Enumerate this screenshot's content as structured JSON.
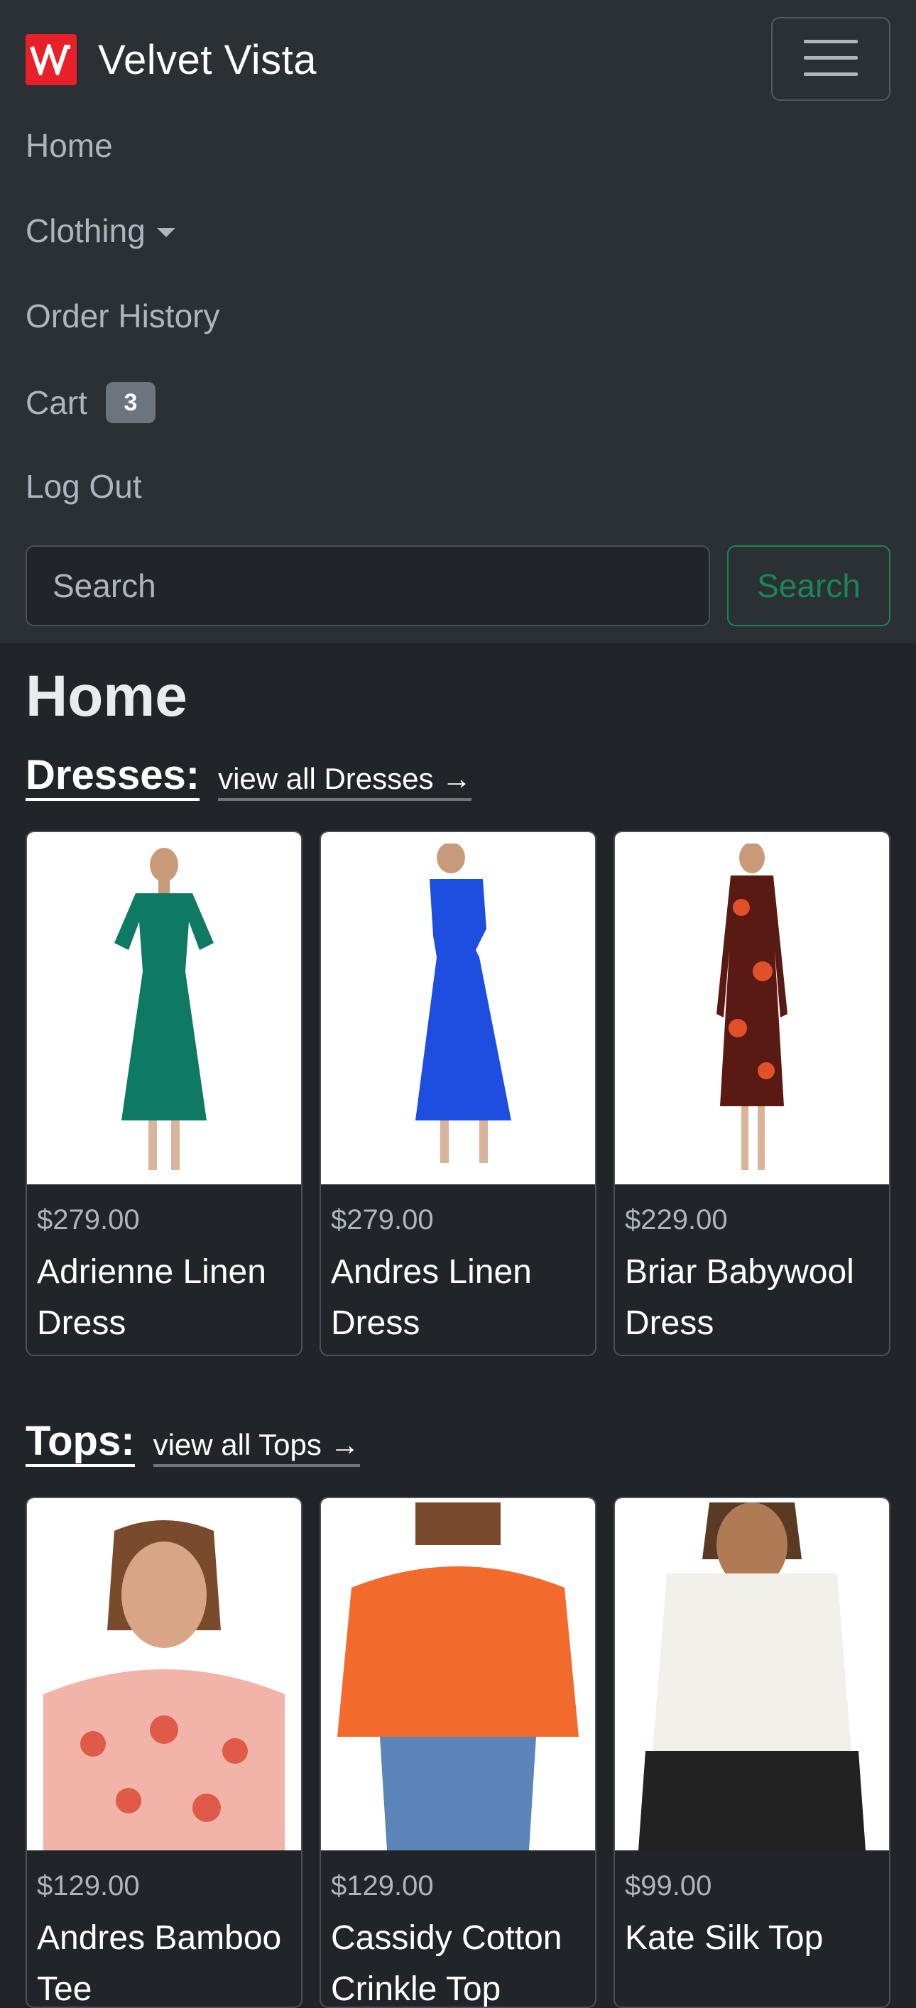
{
  "brand": {
    "name": "Velvet Vista",
    "logo_color": "#e8202a",
    "logo_icon": "vv-logo-icon"
  },
  "nav": {
    "toggler_icon": "hamburger-icon",
    "items": [
      {
        "label": "Home"
      },
      {
        "label": "Clothing",
        "has_dropdown": true
      },
      {
        "label": "Order History"
      },
      {
        "label": "Cart",
        "badge": "3"
      },
      {
        "label": "Log Out"
      }
    ]
  },
  "search": {
    "placeholder": "Search",
    "value": "",
    "button_label": "Search"
  },
  "page": {
    "title": "Home"
  },
  "sections": [
    {
      "title": "Dresses:",
      "view_all": "view all Dresses →",
      "products": [
        {
          "price": "$279.00",
          "name": "Adrienne Linen Dress",
          "image": "green midi dress",
          "color": "#0f7a63"
        },
        {
          "price": "$279.00",
          "name": "Andres Linen Dress",
          "image": "blue midi dress",
          "color": "#1e4ee0"
        },
        {
          "price": "$229.00",
          "name": "Briar Babywool Dress",
          "image": "floral long-sleeve dress",
          "color": "#5a1a14"
        }
      ]
    },
    {
      "title": "Tops:",
      "view_all": "view all Tops →",
      "products": [
        {
          "price": "$129.00",
          "name": "Andres Bamboo Tee",
          "image": "printed pink tee",
          "color": "#f2b3a8"
        },
        {
          "price": "$129.00",
          "name": "Cassidy Cotton Crinkle Top",
          "image": "orange blouse",
          "color": "#f26a2c"
        },
        {
          "price": "$99.00",
          "name": "Kate Silk Top",
          "image": "ivory silk top",
          "color": "#f2f0ea"
        }
      ]
    }
  ],
  "colors": {
    "page_bg": "#212529",
    "navbar_bg": "#2b3035",
    "success": "#198754",
    "muted": "#adb5bd"
  }
}
